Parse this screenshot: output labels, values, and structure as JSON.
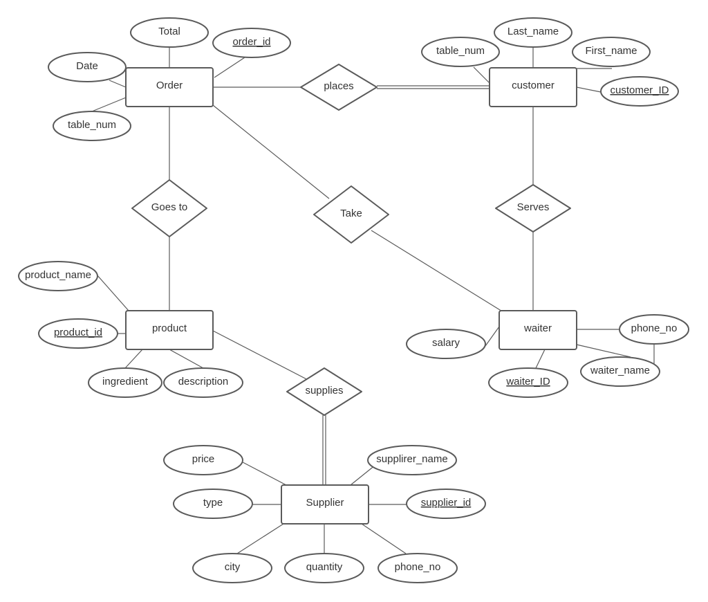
{
  "diagram": {
    "entities": [
      {
        "id": "order",
        "label": "Order"
      },
      {
        "id": "customer",
        "label": "customer"
      },
      {
        "id": "product",
        "label": "product"
      },
      {
        "id": "waiter",
        "label": "waiter"
      },
      {
        "id": "supplier",
        "label": "Supplier"
      }
    ],
    "relationships": [
      {
        "id": "places",
        "label": "places"
      },
      {
        "id": "goes_to",
        "label": "Goes to"
      },
      {
        "id": "take",
        "label": "Take"
      },
      {
        "id": "serves",
        "label": "Serves"
      },
      {
        "id": "supplies",
        "label": "supplies"
      }
    ],
    "attributes": [
      {
        "id": "order_total",
        "label": "Total",
        "key": false
      },
      {
        "id": "order_id",
        "label": "order_id",
        "key": true
      },
      {
        "id": "order_date",
        "label": "Date",
        "key": false
      },
      {
        "id": "order_table_num",
        "label": "table_num",
        "key": false
      },
      {
        "id": "cust_last_name",
        "label": "Last_name",
        "key": false
      },
      {
        "id": "cust_table_num",
        "label": "table_num",
        "key": false
      },
      {
        "id": "cust_first_name",
        "label": "First_name",
        "key": false
      },
      {
        "id": "customer_id",
        "label": "customer_ID",
        "key": true
      },
      {
        "id": "product_name",
        "label": "product_name",
        "key": false
      },
      {
        "id": "product_id",
        "label": "product_id",
        "key": true
      },
      {
        "id": "ingredient",
        "label": "ingredient",
        "key": false
      },
      {
        "id": "description",
        "label": "description",
        "key": false
      },
      {
        "id": "salary",
        "label": "salary",
        "key": false
      },
      {
        "id": "waiter_phone",
        "label": "phone_no",
        "key": false
      },
      {
        "id": "waiter_name",
        "label": "waiter_name",
        "key": false
      },
      {
        "id": "waiter_id",
        "label": "waiter_ID",
        "key": true
      },
      {
        "id": "price",
        "label": "price",
        "key": false
      },
      {
        "id": "supplier_name",
        "label": "supplirer_name",
        "key": false
      },
      {
        "id": "type",
        "label": "type",
        "key": false
      },
      {
        "id": "supplier_id",
        "label": "supplier_id",
        "key": true
      },
      {
        "id": "city",
        "label": "city",
        "key": false
      },
      {
        "id": "quantity",
        "label": "quantity",
        "key": false
      },
      {
        "id": "supplier_phone",
        "label": "phone_no",
        "key": false
      }
    ],
    "double_lines": [
      "places-customer",
      "supplies-supplier"
    ],
    "colors": {
      "stroke": "#5a5a5a",
      "text": "#333333",
      "background": "#ffffff"
    }
  }
}
